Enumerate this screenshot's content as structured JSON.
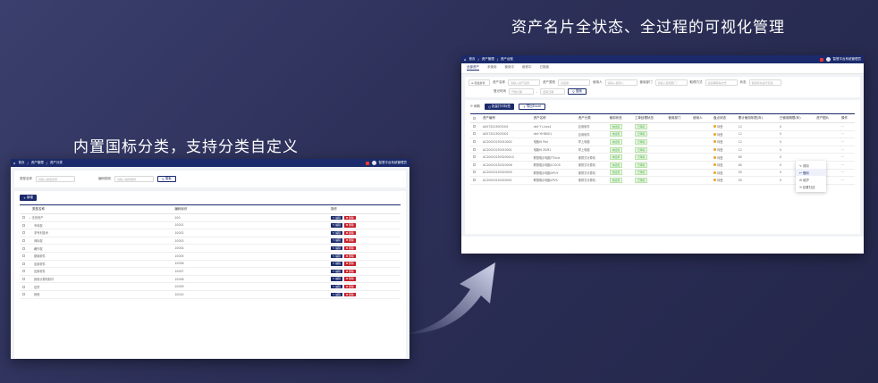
{
  "headlines": {
    "left": "内置国标分类，支持分类自定义",
    "right": "资产名片全状态、全过程的可视化管理"
  },
  "colors": {
    "brand": "#1a2a6c",
    "danger": "#c41e2a",
    "success": "#4caf50",
    "warning": "#f0a020"
  },
  "left": {
    "topbar": {
      "home": "首页",
      "bc1": "资产管理",
      "bc2": "资产分类",
      "user": "智慧平台系统管理员"
    },
    "filters": {
      "type_label": "类型名称",
      "type_ph": "请输入类型名称",
      "code_label": "编码规则",
      "code_ph": "请输入编码规则",
      "search": "搜索"
    },
    "add": "新增",
    "headers": [
      "类型名称",
      "编码标识",
      "操作"
    ],
    "rows": [
      {
        "name": "无形资产",
        "code": "100"
      },
      {
        "name": "专利权",
        "code": "10001"
      },
      {
        "name": "非专利技术",
        "code": "10002"
      },
      {
        "name": "商标权",
        "code": "10003"
      },
      {
        "name": "著作权",
        "code": "10004"
      },
      {
        "name": "基础软件",
        "code": "10005"
      },
      {
        "name": "应用软件",
        "code": "10006"
      },
      {
        "name": "应用软件",
        "code": "10007"
      },
      {
        "name": "其他计算机软件",
        "code": "10008"
      },
      {
        "name": "信誉",
        "code": "10009"
      },
      {
        "name": "其他",
        "code": "10010"
      }
    ],
    "edit": "编辑",
    "delete": "删除"
  },
  "right": {
    "topbar": {
      "home": "首页",
      "bc1": "资产管理",
      "bc2": "资产台账",
      "user": "智慧平台系统管理员"
    },
    "tabs": [
      "全部资产",
      "未使用",
      "使用中",
      "维修中",
      "已报废"
    ],
    "filters": {
      "tree": "筛选条件",
      "name_l": "资产名称",
      "name_ph": "请输入资产名称",
      "type_l": "资产类别",
      "type_ph": "请选择",
      "user_l": "使用人",
      "user_ph": "请输入使用人",
      "dept_l": "使用部门",
      "dept_ph": "请输入使用部门",
      "way_l": "取得方式",
      "way_ph": "请选择取得方式",
      "status_l": "状态",
      "status_ph": "使用状态进行筛选",
      "time_l": "登记时间",
      "start_ph": "开始日期",
      "end_ph": "结束日期",
      "search": "搜索"
    },
    "tools": {
      "refresh": "刷新",
      "print": "批量打印标签",
      "export": "导出Excel"
    },
    "headers": [
      "资产编号",
      "资产名称",
      "资产分类",
      "使用状态",
      "工单处理状态",
      "使用部门",
      "使用人",
      "盘点状态",
      "累计使用年限(年)",
      "已使用期限(年)",
      "资产图片",
      "操作"
    ],
    "rows": [
      {
        "no": "A0072023003002",
        "name": "dell Y Lives1",
        "cat": "应用软件",
        "use": "未使用",
        "work": "已审核",
        "check": "待盘",
        "yrs": "12",
        "used": "0"
      },
      {
        "no": "A0072023003001",
        "name": "dell YIHNS01",
        "cat": "应用软件",
        "use": "未使用",
        "work": "已审核",
        "check": "待盘",
        "yrs": "12",
        "used": "0"
      },
      {
        "no": "AC20020230010002",
        "name": "电脑Hi Pari",
        "cat": "掌上电脑",
        "use": "未使用",
        "work": "已审核",
        "check": "待盘",
        "yrs": "12",
        "used": "0"
      },
      {
        "no": "AC20020230010001",
        "name": "电脑Hi Z0M1",
        "cat": "掌上电脑",
        "use": "未使用",
        "work": "已审核",
        "check": "待盘",
        "yrs": "12",
        "used": "0"
      },
      {
        "no": "AC200202300200010",
        "name": "联想昭示电脑TThink",
        "cat": "便携式计算机",
        "use": "未使用",
        "work": "已审核",
        "check": "待盘",
        "yrs": "60",
        "used": "0"
      },
      {
        "no": "AC20020230020006",
        "name": "联想昭示电脑LCOOS",
        "cat": "便携式计算机",
        "use": "未使用",
        "work": "已审核",
        "check": "待盘",
        "yrs": "60",
        "used": "0"
      },
      {
        "no": "AC20020230020005",
        "name": "联想昭示电脑OPUY",
        "cat": "便携式计算机",
        "use": "未使用",
        "work": "已审核",
        "check": "待盘",
        "yrs": "50",
        "used": "0"
      },
      {
        "no": "AC20020230020001",
        "name": "联想昭示电脑LPVS",
        "cat": "便携式计算机",
        "use": "未使用",
        "work": "已审核",
        "check": "待盘",
        "yrs": "50",
        "used": "0"
      }
    ],
    "menu": [
      "领用",
      "借用",
      "维护",
      "处置归还"
    ]
  }
}
